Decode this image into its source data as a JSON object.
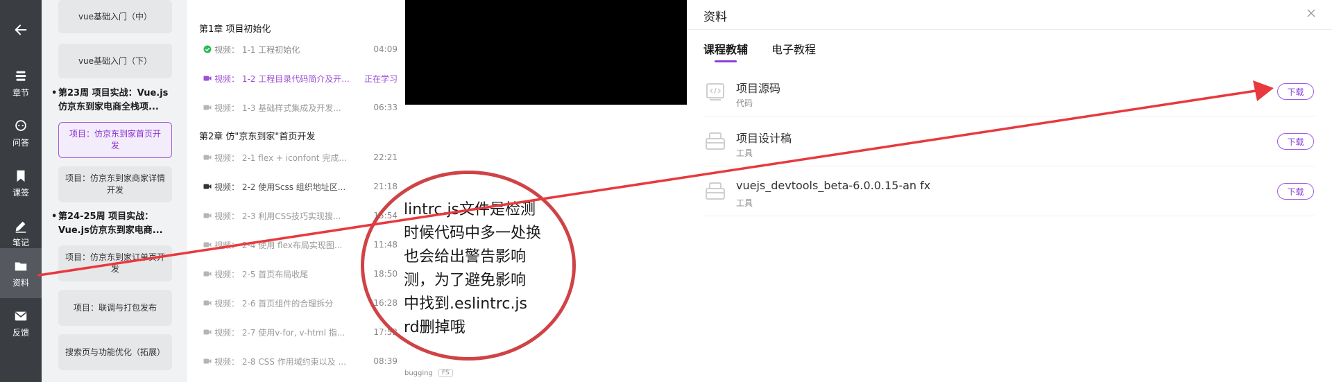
{
  "rail": {
    "back_icon": "arrow-left-icon",
    "items": [
      {
        "label": "章节",
        "icon": "stack-icon"
      },
      {
        "label": "问答",
        "icon": "chat-icon"
      },
      {
        "label": "课签",
        "icon": "bookmark-icon"
      },
      {
        "label": "笔记",
        "icon": "pencil-icon"
      },
      {
        "label": "资料",
        "icon": "folder-icon"
      },
      {
        "label": "反馈",
        "icon": "mail-icon"
      }
    ]
  },
  "outline": {
    "lessons_top": [
      "vue基础入门（中）",
      "vue基础入门（下）"
    ],
    "week23": "第23周 项目实战：Vue.js仿京东到家电商全栈项...",
    "week23_lines": [
      "第23周 项目实战：Vue.js",
      "仿京东到家电商全栈项..."
    ],
    "lesson_active": "项目：仿京东到家首页开发",
    "lesson_2": "项目：仿京东到家商家详情开发",
    "week24_lines": [
      "第24-25周 项目实战：",
      "Vue.js仿京东到家电商..."
    ],
    "lesson_3": "项目：仿京东到家订单页开发",
    "lesson_4": "项目：联调与打包发布",
    "lesson_5": "搜索页与功能优化（拓展）",
    "bullet": "•"
  },
  "chapters": {
    "chapter1": "第1章  项目初始化",
    "chapter2": "第2章  仿\"京东到家\"首页开发",
    "videos_ch1": [
      {
        "title": "视频：  1-1 工程初始化",
        "time": "04:09",
        "state": "done"
      },
      {
        "title": "视频：  1-2 工程目录代码简介及开...",
        "time": "正在学习",
        "state": "current"
      },
      {
        "title": "视频：  1-3 基础样式集成及开发...",
        "time": "06:33",
        "state": "grey"
      }
    ],
    "videos_ch2": [
      {
        "title": "视频：  2-1 flex + iconfont 完成...",
        "time": "22:21",
        "state": "grey"
      },
      {
        "title": "视频：  2-2 使用Scss 组织地址区...",
        "time": "21:18",
        "state": "dark"
      },
      {
        "title": "视频：  2-3 利用CSS技巧实现搜...",
        "time": "15:54",
        "state": "grey"
      },
      {
        "title": "视频：  2-4 使用 flex布局实现图...",
        "time": "11:48",
        "state": "grey"
      },
      {
        "title": "视频：  2-5 首页布局收尾",
        "time": "18:50",
        "state": "grey"
      },
      {
        "title": "视频：  2-6 首页组件的合理拆分",
        "time": "16:28",
        "state": "grey"
      },
      {
        "title": "视频：  2-7 使用v-for, v-html 指...",
        "time": "17:52",
        "state": "grey"
      },
      {
        "title": "视频：  2-8 CSS 作用域约束以及 ...",
        "time": "08:39",
        "state": "grey"
      }
    ]
  },
  "note": {
    "lines": [
      "lintrc.js文件是检测",
      "时候代码中多一处换",
      "也会给出警告影响",
      "测，为了避免影响",
      "中找到.eslintrc.js",
      "rd删掉哦"
    ],
    "tag_1": "bugging",
    "tag_2": "FS"
  },
  "panel": {
    "title": "资料",
    "tabs": [
      "课程教辅",
      "电子教程"
    ],
    "resources": [
      {
        "name": "项目源码",
        "type": "代码",
        "button": "下载",
        "icon": "code-file-icon"
      },
      {
        "name": "项目设计稿",
        "type": "工具",
        "button": "下载",
        "icon": "toolbox-icon"
      },
      {
        "name": "vuejs_devtools_beta-6.0.0.15-an fx",
        "type": "工具",
        "button": "下载",
        "icon": "toolbox-icon"
      }
    ]
  },
  "colors": {
    "accent": "#8a3fd6",
    "rail_bg": "#3a3d42",
    "annotation": "#e8393e",
    "done_check": "#2dbb55"
  }
}
